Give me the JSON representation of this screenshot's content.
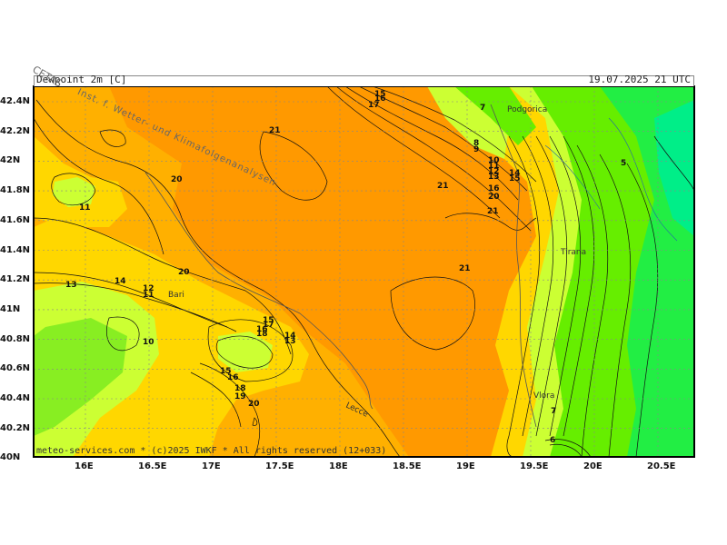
{
  "header": {
    "title_left": "Dewpoint 2m [C]",
    "title_right": "19.07.2025 21 UTC"
  },
  "watermark": {
    "line1": "CETAS",
    "line2": "Inst. f. Wetter- und Klimafolgenanalysen"
  },
  "footer": "meteo-services.com * (c)2025 IWKF * All rights reserved (12+033)",
  "axes": {
    "y_ticks": [
      "42.4N",
      "42.2N",
      "42N",
      "41.8N",
      "41.6N",
      "41.4N",
      "41.2N",
      "41N",
      "40.8N",
      "40.6N",
      "40.4N",
      "40.2N",
      "40N"
    ],
    "x_ticks": [
      "16E",
      "16.5E",
      "17E",
      "17.5E",
      "18E",
      "18.5E",
      "19E",
      "19.5E",
      "20E",
      "20.5E"
    ]
  },
  "cities": [
    "Podgorica",
    "Tirana",
    "Bari",
    "Lecce",
    "Vlora"
  ],
  "contour_labels": [
    "15",
    "16",
    "17",
    "7",
    "8",
    "9",
    "10",
    "11",
    "12",
    "13",
    "14",
    "15",
    "16",
    "20",
    "21",
    "5",
    "21",
    "20",
    "11",
    "13",
    "14",
    "12",
    "11",
    "20",
    "21",
    "10",
    "15",
    "14",
    "13",
    "18",
    "17",
    "16",
    "15",
    "16",
    "18",
    "19",
    "20",
    "21",
    "7",
    "6"
  ],
  "colors": {
    "orange": "#ff9900",
    "light_orange": "#ffb000",
    "yellow": "#ffd700",
    "yellow_green": "#ccff33",
    "green": "#66ee00",
    "bright_green": "#22ee44",
    "sea_green": "#00ee88"
  }
}
